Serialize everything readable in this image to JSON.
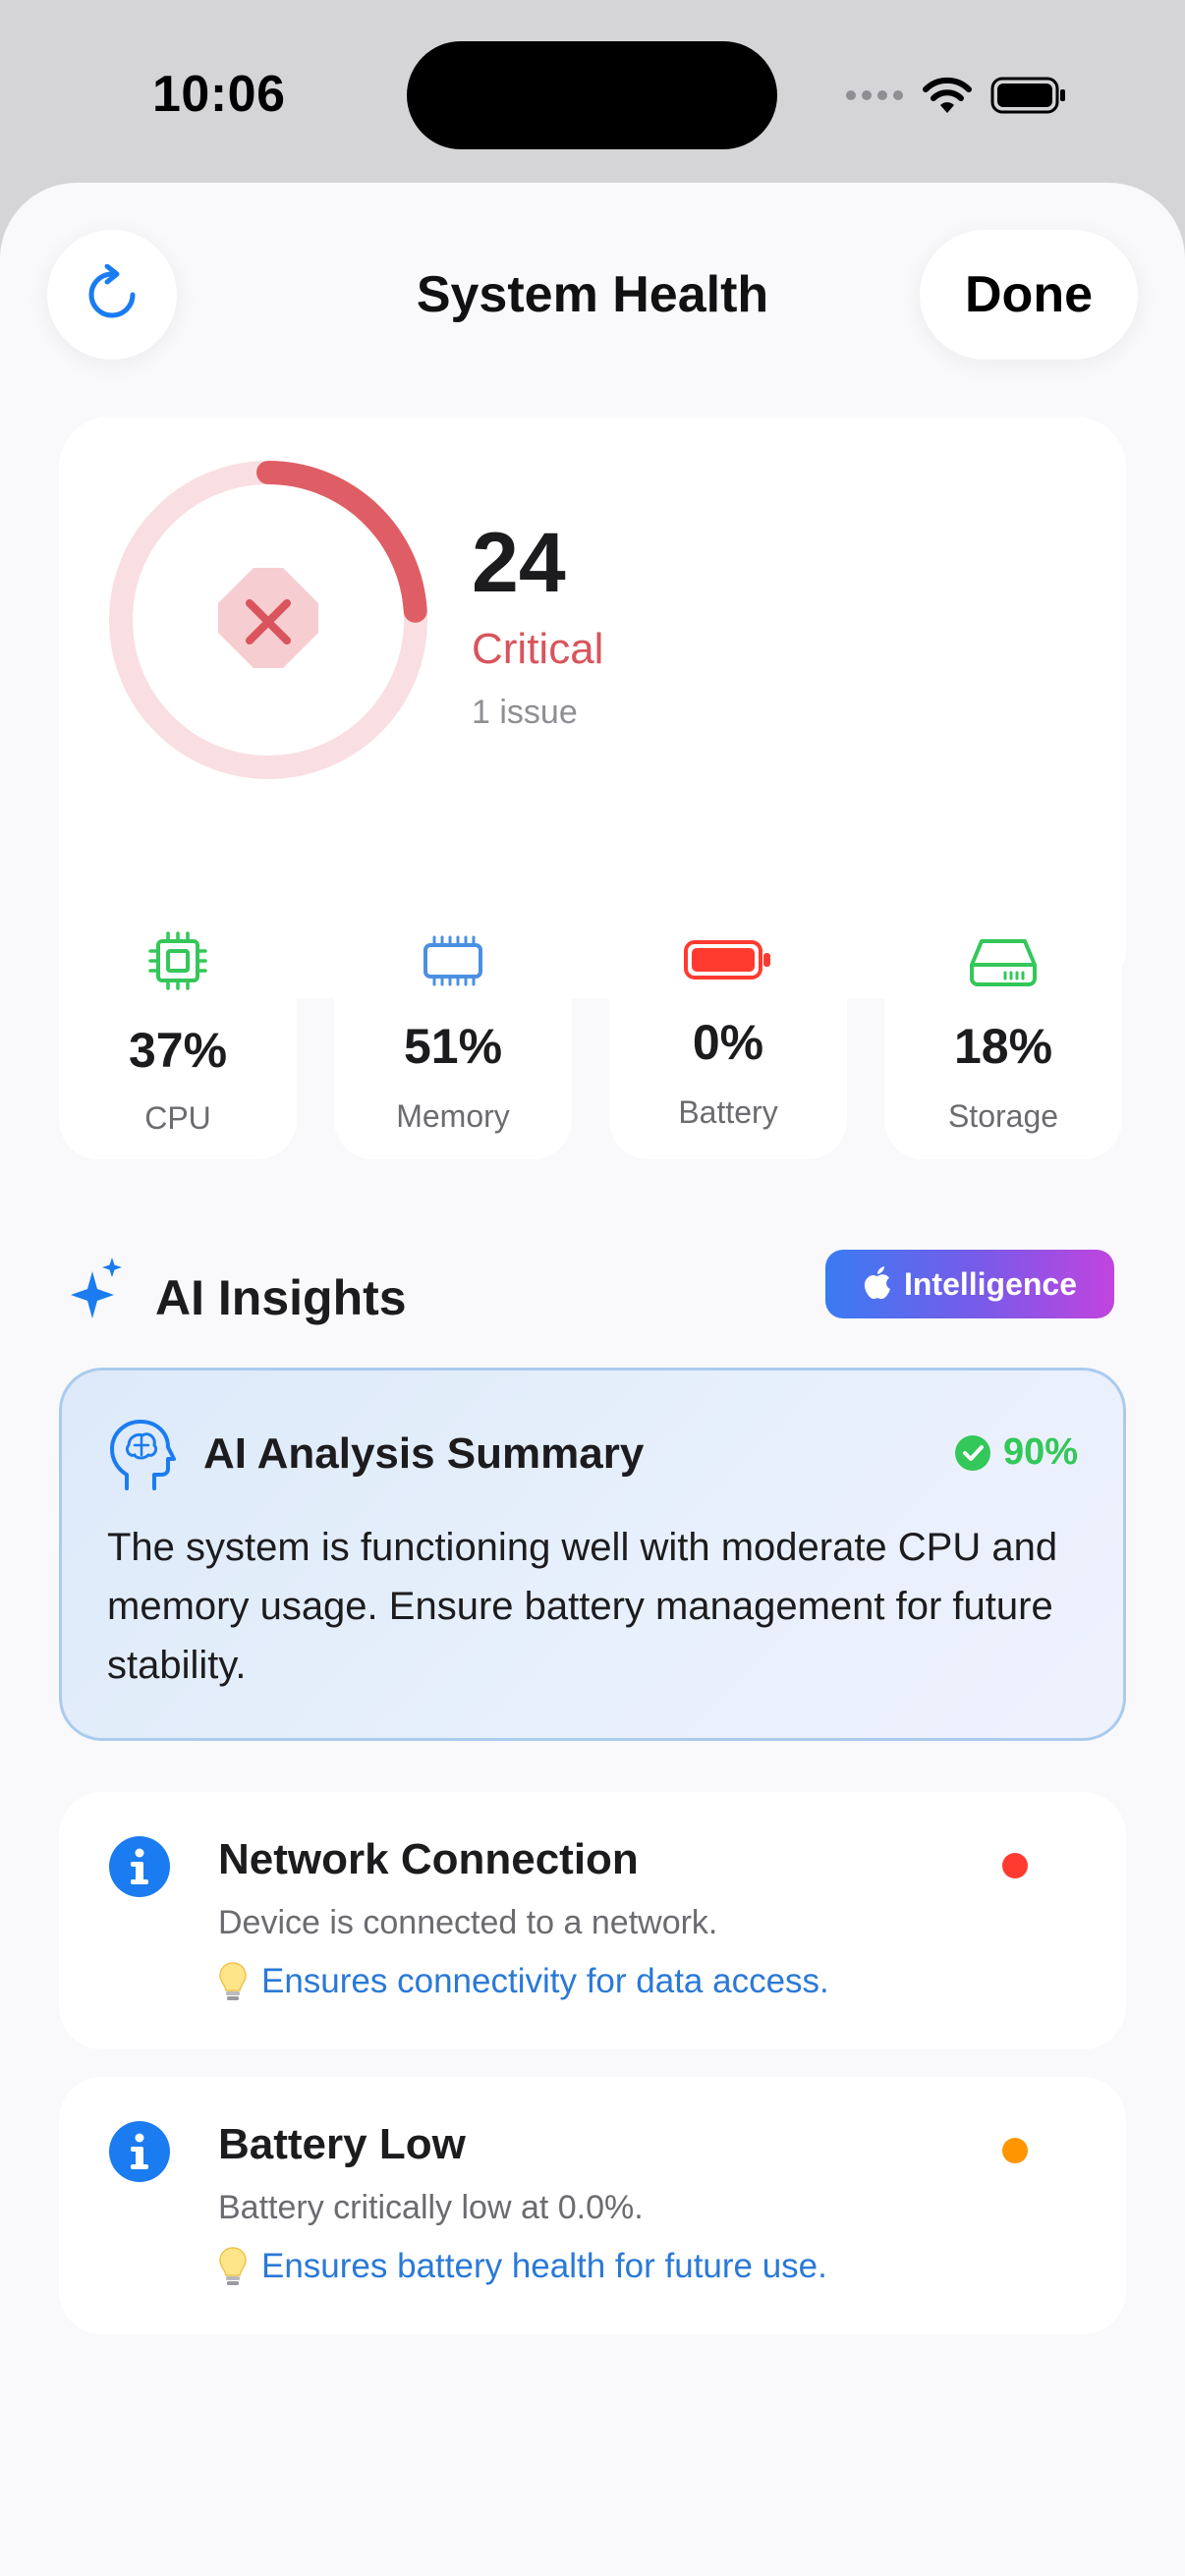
{
  "status_bar": {
    "time": "10:06"
  },
  "nav": {
    "title": "System Health",
    "done_label": "Done",
    "refresh_icon": "refresh-icon"
  },
  "score": {
    "value": "24",
    "status": "Critical",
    "issues": "1 issue",
    "progress": 0.24,
    "color": "#df5e66"
  },
  "metrics": [
    {
      "value": "37%",
      "label": "CPU",
      "icon": "cpu-icon",
      "color": "#34c759"
    },
    {
      "value": "51%",
      "label": "Memory",
      "icon": "memory-icon",
      "color": "#4a90e2"
    },
    {
      "value": "0%",
      "label": "Battery",
      "icon": "battery-icon",
      "color": "#ff3b30"
    },
    {
      "value": "18%",
      "label": "Storage",
      "icon": "storage-icon",
      "color": "#34c759"
    }
  ],
  "ai_insights": {
    "title": "AI Insights",
    "badge": "Intelligence",
    "summary": {
      "title": "AI Analysis Summary",
      "confidence": "90%",
      "text": "The system is functioning well with moderate CPU and memory usage. Ensure battery management for future stability."
    }
  },
  "issues": [
    {
      "title": "Network Connection",
      "description": "Device is connected to a network.",
      "tip": "Ensures connectivity for data access.",
      "dot_color": "#ff3b30"
    },
    {
      "title": "Battery Low",
      "description": "Battery critically low at 0.0%.",
      "tip": "Ensures battery health for future use.",
      "dot_color": "#ff9500"
    }
  ]
}
